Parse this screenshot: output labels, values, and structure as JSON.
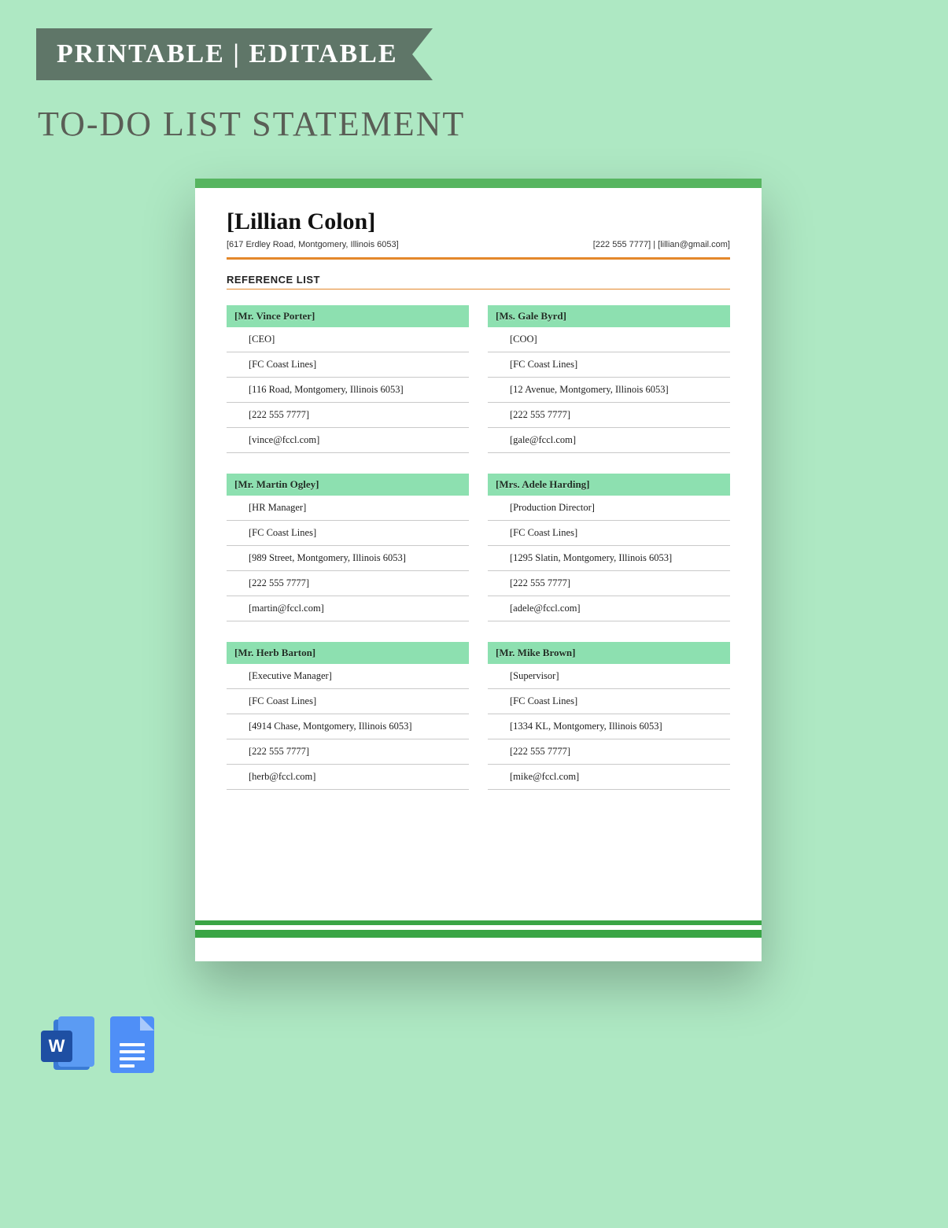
{
  "ribbon": "PRINTABLE | EDITABLE",
  "title": "TO-DO LIST STATEMENT",
  "doc": {
    "name": "[Lillian Colon]",
    "address": "[617 Erdley Road, Montgomery, Illinois 6053]",
    "contact": "[222 555 7777] | [lillian@gmail.com]",
    "section": "REFERENCE LIST",
    "refs": [
      {
        "name": "[Mr. Vince Porter]",
        "rows": [
          "[CEO]",
          "[FC Coast Lines]",
          "[116 Road, Montgomery, Illinois 6053]",
          "[222 555 7777]",
          "[vince@fccl.com]"
        ]
      },
      {
        "name": "[Ms. Gale Byrd]",
        "rows": [
          "[COO]",
          "[FC Coast Lines]",
          "[12 Avenue, Montgomery, Illinois 6053]",
          "[222 555 7777]",
          "[gale@fccl.com]"
        ]
      },
      {
        "name": "[Mr. Martin Ogley]",
        "rows": [
          "[HR Manager]",
          "[FC Coast Lines]",
          "[989 Street, Montgomery, Illinois 6053]",
          "[222 555 7777]",
          "[martin@fccl.com]"
        ]
      },
      {
        "name": "[Mrs. Adele Harding]",
        "rows": [
          "[Production Director]",
          "[FC Coast Lines]",
          "[1295 Slatin, Montgomery, Illinois 6053]",
          "[222 555 7777]",
          "[adele@fccl.com]"
        ]
      },
      {
        "name": "[Mr. Herb Barton]",
        "rows": [
          "[Executive Manager]",
          "[FC Coast Lines]",
          "[4914 Chase, Montgomery, Illinois 6053]",
          "[222 555 7777]",
          "[herb@fccl.com]"
        ]
      },
      {
        "name": "[Mr. Mike Brown]",
        "rows": [
          "[Supervisor]",
          "[FC Coast Lines]",
          "[1334 KL, Montgomery, Illinois 6053]",
          "[222 555 7777]",
          "[mike@fccl.com]"
        ]
      }
    ]
  },
  "icons": {
    "word": "W"
  }
}
